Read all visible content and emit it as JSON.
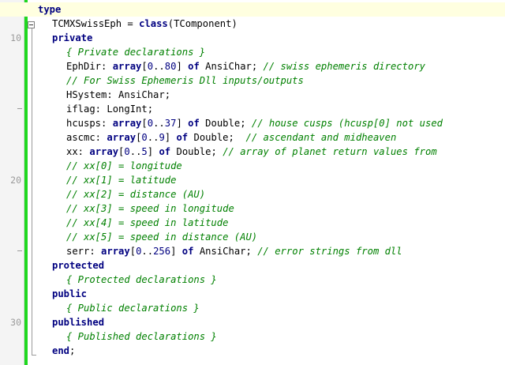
{
  "editor": {
    "colors": {
      "keyword": "#000080",
      "comment": "#008000",
      "text": "#000000",
      "modified_bar": "#1fd81f"
    },
    "lines": [
      {
        "num": "",
        "active": true,
        "mark": "",
        "indent": 0,
        "tokens": [
          {
            "t": "kw",
            "v": "type"
          }
        ]
      },
      {
        "num": "",
        "fold": true,
        "indent": 1,
        "tokens": [
          {
            "t": "pl",
            "v": "TCMXSwissEph = "
          },
          {
            "t": "kw",
            "v": "class"
          },
          {
            "t": "pl",
            "v": "(TComponent)"
          }
        ]
      },
      {
        "num": "10",
        "indent": 1,
        "tokens": [
          {
            "t": "kw",
            "v": "private"
          }
        ]
      },
      {
        "num": "",
        "indent": 2,
        "tokens": [
          {
            "t": "cm",
            "v": "{ Private declarations }"
          }
        ]
      },
      {
        "num": "",
        "indent": 2,
        "tokens": [
          {
            "t": "pl",
            "v": "EphDir: "
          },
          {
            "t": "kw",
            "v": "array"
          },
          {
            "t": "pl",
            "v": "["
          },
          {
            "t": "num",
            "v": "0"
          },
          {
            "t": "pl",
            "v": ".."
          },
          {
            "t": "num",
            "v": "80"
          },
          {
            "t": "pl",
            "v": "] "
          },
          {
            "t": "kw",
            "v": "of"
          },
          {
            "t": "pl",
            "v": " AnsiChar; "
          },
          {
            "t": "cm",
            "v": "// swiss ephemeris directory"
          }
        ]
      },
      {
        "num": "",
        "indent": 2,
        "tokens": [
          {
            "t": "cm",
            "v": "// For Swiss Ephemeris Dll inputs/outputs"
          }
        ]
      },
      {
        "num": "",
        "indent": 2,
        "tokens": [
          {
            "t": "pl",
            "v": "HSystem: AnsiChar;"
          }
        ]
      },
      {
        "num": "",
        "mark": "tick",
        "indent": 2,
        "tokens": [
          {
            "t": "pl",
            "v": "iflag: LongInt;"
          }
        ]
      },
      {
        "num": "",
        "indent": 2,
        "tokens": [
          {
            "t": "pl",
            "v": "hcusps: "
          },
          {
            "t": "kw",
            "v": "array"
          },
          {
            "t": "pl",
            "v": "["
          },
          {
            "t": "num",
            "v": "0"
          },
          {
            "t": "pl",
            "v": ".."
          },
          {
            "t": "num",
            "v": "37"
          },
          {
            "t": "pl",
            "v": "] "
          },
          {
            "t": "kw",
            "v": "of"
          },
          {
            "t": "pl",
            "v": " Double; "
          },
          {
            "t": "cm",
            "v": "// house cusps (hcusp[0] not used"
          }
        ]
      },
      {
        "num": "",
        "indent": 2,
        "tokens": [
          {
            "t": "pl",
            "v": "ascmc: "
          },
          {
            "t": "kw",
            "v": "array"
          },
          {
            "t": "pl",
            "v": "["
          },
          {
            "t": "num",
            "v": "0"
          },
          {
            "t": "pl",
            "v": ".."
          },
          {
            "t": "num",
            "v": "9"
          },
          {
            "t": "pl",
            "v": "] "
          },
          {
            "t": "kw",
            "v": "of"
          },
          {
            "t": "pl",
            "v": " Double;  "
          },
          {
            "t": "cm",
            "v": "// ascendant and midheaven"
          }
        ]
      },
      {
        "num": "",
        "indent": 2,
        "tokens": [
          {
            "t": "pl",
            "v": "xx: "
          },
          {
            "t": "kw",
            "v": "array"
          },
          {
            "t": "pl",
            "v": "["
          },
          {
            "t": "num",
            "v": "0"
          },
          {
            "t": "pl",
            "v": ".."
          },
          {
            "t": "num",
            "v": "5"
          },
          {
            "t": "pl",
            "v": "] "
          },
          {
            "t": "kw",
            "v": "of"
          },
          {
            "t": "pl",
            "v": " Double; "
          },
          {
            "t": "cm",
            "v": "// array of planet return values from"
          }
        ]
      },
      {
        "num": "",
        "indent": 2,
        "tokens": [
          {
            "t": "cm",
            "v": "// xx[0] = longitude"
          }
        ]
      },
      {
        "num": "20",
        "indent": 2,
        "tokens": [
          {
            "t": "cm",
            "v": "// xx[1] = latitude"
          }
        ]
      },
      {
        "num": "",
        "indent": 2,
        "tokens": [
          {
            "t": "cm",
            "v": "// xx[2] = distance (AU)"
          }
        ]
      },
      {
        "num": "",
        "indent": 2,
        "tokens": [
          {
            "t": "cm",
            "v": "// xx[3] = speed in longitude"
          }
        ]
      },
      {
        "num": "",
        "indent": 2,
        "tokens": [
          {
            "t": "cm",
            "v": "// xx[4] = speed in latitude"
          }
        ]
      },
      {
        "num": "",
        "indent": 2,
        "tokens": [
          {
            "t": "cm",
            "v": "// xx[5] = speed in distance (AU)"
          }
        ]
      },
      {
        "num": "",
        "mark": "tick",
        "indent": 2,
        "tokens": [
          {
            "t": "pl",
            "v": "serr: "
          },
          {
            "t": "kw",
            "v": "array"
          },
          {
            "t": "pl",
            "v": "["
          },
          {
            "t": "num",
            "v": "0"
          },
          {
            "t": "pl",
            "v": ".."
          },
          {
            "t": "num",
            "v": "256"
          },
          {
            "t": "pl",
            "v": "] "
          },
          {
            "t": "kw",
            "v": "of"
          },
          {
            "t": "pl",
            "v": " AnsiChar; "
          },
          {
            "t": "cm",
            "v": "// error strings from dll"
          }
        ]
      },
      {
        "num": "",
        "indent": 1,
        "tokens": [
          {
            "t": "kw",
            "v": "protected"
          }
        ]
      },
      {
        "num": "",
        "indent": 2,
        "tokens": [
          {
            "t": "cm",
            "v": "{ Protected declarations }"
          }
        ]
      },
      {
        "num": "",
        "indent": 1,
        "tokens": [
          {
            "t": "kw",
            "v": "public"
          }
        ]
      },
      {
        "num": "",
        "indent": 2,
        "tokens": [
          {
            "t": "cm",
            "v": "{ Public declarations }"
          }
        ]
      },
      {
        "num": "30",
        "indent": 1,
        "tokens": [
          {
            "t": "kw",
            "v": "published"
          }
        ]
      },
      {
        "num": "",
        "indent": 2,
        "tokens": [
          {
            "t": "cm",
            "v": "{ Published declarations }"
          }
        ]
      },
      {
        "num": "",
        "indent": 1,
        "tokens": [
          {
            "t": "kw",
            "v": "end"
          },
          {
            "t": "pl",
            "v": ";"
          }
        ]
      }
    ]
  }
}
